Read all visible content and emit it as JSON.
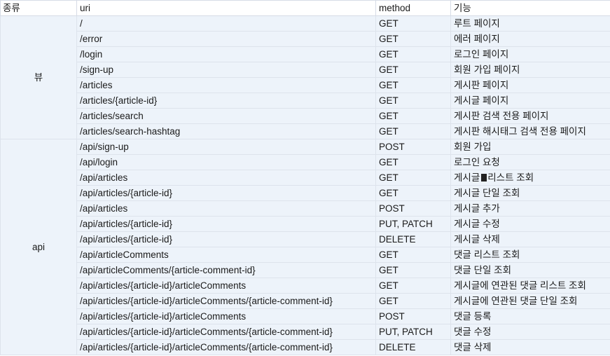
{
  "headers": {
    "kind": "종류",
    "uri": "uri",
    "method": "method",
    "func": "기능"
  },
  "groups": {
    "view": "뷰",
    "api": "api"
  },
  "rows": [
    {
      "uri": "/",
      "method": "GET",
      "func": "루트 페이지"
    },
    {
      "uri": "/error",
      "method": "GET",
      "func": "에러 페이지"
    },
    {
      "uri": "/login",
      "method": "GET",
      "func": "로그인 페이지"
    },
    {
      "uri": "/sign-up",
      "method": "GET",
      "func": "회원 가입 페이지"
    },
    {
      "uri": "/articles",
      "method": "GET",
      "func": "게시판 페이지"
    },
    {
      "uri": "/articles/{article-id}",
      "method": "GET",
      "func": "게시글 페이지"
    },
    {
      "uri": "/articles/search",
      "method": "GET",
      "func": "게시판 검색 전용 페이지"
    },
    {
      "uri": "/articles/search-hashtag",
      "method": "GET",
      "func": "게시판 해시태그 검색 전용 페이지"
    },
    {
      "uri": "/api/sign-up",
      "method": "POST",
      "func": "회원 가입"
    },
    {
      "uri": "/api/login",
      "method": "GET",
      "func": "로그인 요청"
    },
    {
      "uri": "/api/articles",
      "method": "GET",
      "func_a": "게시글",
      "func_b": "리스트 조회"
    },
    {
      "uri": "/api/articles/{article-id}",
      "method": "GET",
      "func": "게시글 단일 조회"
    },
    {
      "uri": "/api/articles",
      "method": "POST",
      "func": "게시글 추가"
    },
    {
      "uri": "/api/articles/{article-id}",
      "method": "PUT, PATCH",
      "func": "게시글 수정"
    },
    {
      "uri": "/api/articles/{article-id}",
      "method": "DELETE",
      "func": "게시글 삭제"
    },
    {
      "uri": "/api/articleComments",
      "method": "GET",
      "func": "댓글 리스트 조회"
    },
    {
      "uri": "/api/articleComments/{article-comment-id}",
      "method": "GET",
      "func": "댓글 단일 조회"
    },
    {
      "uri": "/api/articles/{article-id}/articleComments",
      "method": "GET",
      "func": "게시글에 연관된 댓글 리스트 조회"
    },
    {
      "uri": "/api/articles/{article-id}/articleComments/{article-comment-id}",
      "method": "GET",
      "func": "게시글에 연관된 댓글 단일 조회"
    },
    {
      "uri": "/api/articles/{article-id}/articleComments",
      "method": "POST",
      "func": "댓글 등록"
    },
    {
      "uri": "/api/articles/{article-id}/articleComments/{article-comment-id}",
      "method": "PUT, PATCH",
      "func": "댓글 수정"
    },
    {
      "uri": "/api/articles/{article-id}/articleComments/{article-comment-id}",
      "method": "DELETE",
      "func": "댓글 삭제"
    }
  ]
}
